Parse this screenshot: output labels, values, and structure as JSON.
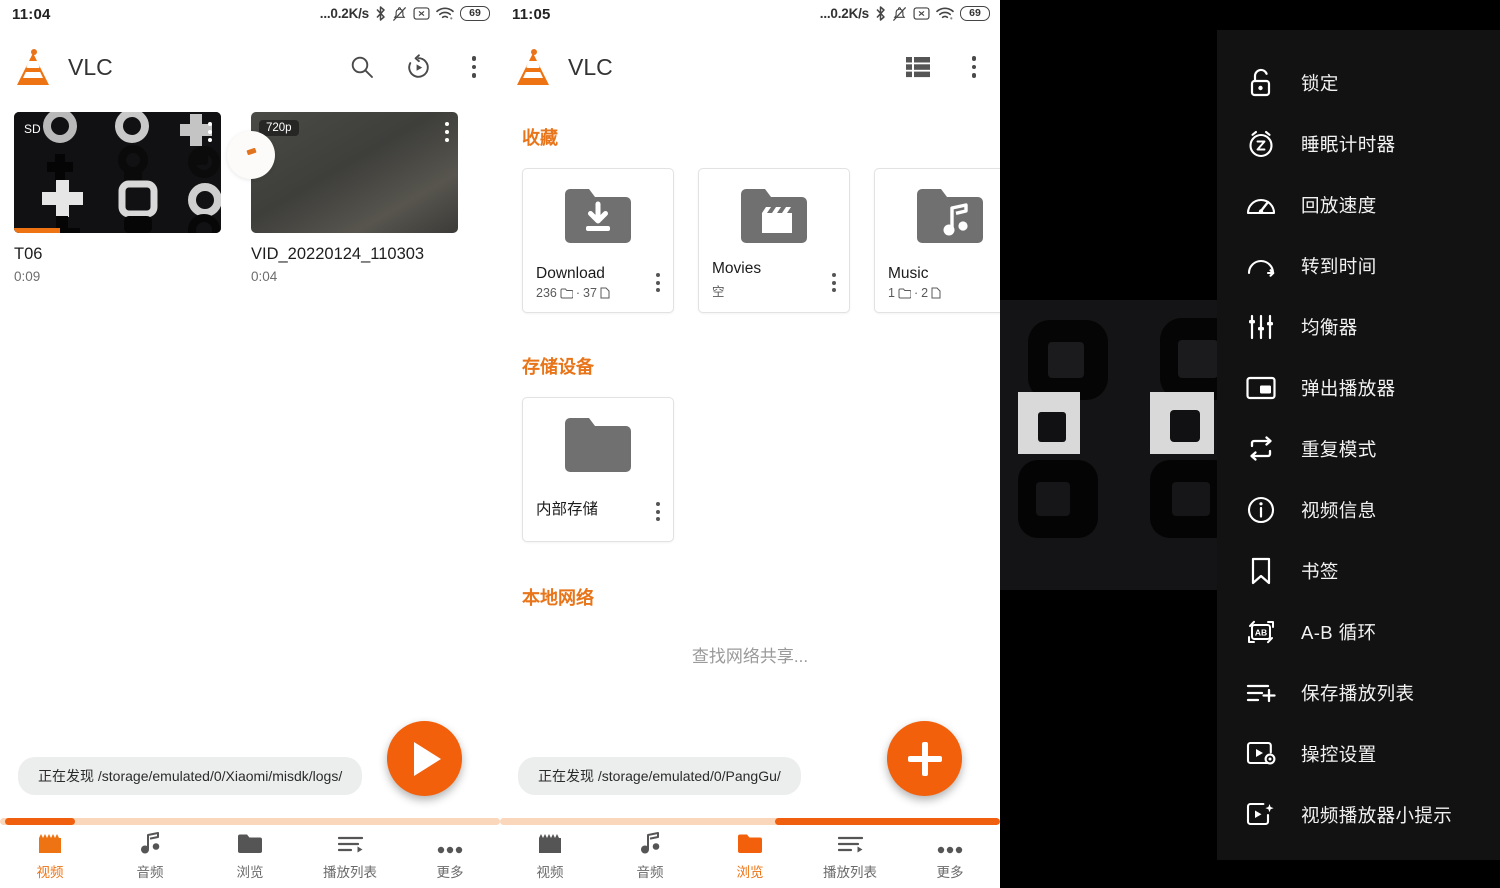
{
  "panel1": {
    "status": {
      "time": "11:04",
      "net_speed": "...0.2K/s",
      "battery": "69",
      "icons": [
        "bluetooth-icon",
        "bell-muted-icon",
        "x-box-icon",
        "wifi-icon",
        "battery-icon"
      ]
    },
    "appbar": {
      "title": "VLC",
      "actions": [
        "search-icon",
        "history-resume-icon",
        "overflow-menu-icon"
      ]
    },
    "videos": [
      {
        "title": "T06",
        "duration": "0:09",
        "quality_badge": "SD",
        "watched_percent": 22
      },
      {
        "title": "VID_20220124_110303",
        "duration": "0:04",
        "quality_badge": "720p",
        "watched_percent": 0
      }
    ],
    "toast": "正在发现 /storage/emulated/0/Xiaomi/misdk/logs/",
    "fab": {
      "icon": "play-icon"
    },
    "progress": {
      "start_percent": 1,
      "end_percent": 15
    },
    "bottomnav": [
      {
        "label": "视频",
        "icon": "video-icon",
        "active": true
      },
      {
        "label": "音频",
        "icon": "audio-icon",
        "active": false
      },
      {
        "label": "浏览",
        "icon": "browse-folder-icon",
        "active": false
      },
      {
        "label": "播放列表",
        "icon": "playlist-icon",
        "active": false
      },
      {
        "label": "更多",
        "icon": "more-icon",
        "active": false
      }
    ]
  },
  "panel2": {
    "status": {
      "time": "11:05",
      "net_speed": "...0.2K/s",
      "battery": "69",
      "icons": [
        "bluetooth-icon",
        "bell-muted-icon",
        "x-box-icon",
        "wifi-icon",
        "battery-icon"
      ]
    },
    "appbar": {
      "title": "VLC",
      "actions": [
        "list-view-icon",
        "overflow-menu-icon"
      ]
    },
    "sections": {
      "favorites_title": "收藏",
      "favorites": [
        {
          "name": "Download",
          "sub": "236 · 37",
          "folders": "236",
          "files": "37",
          "icon": "folder-download-icon"
        },
        {
          "name": "Movies",
          "sub": "空",
          "icon": "folder-movie-icon"
        },
        {
          "name": "Music",
          "sub": "1 · 2",
          "folders": "1",
          "files": "2",
          "icon": "folder-music-icon"
        }
      ],
      "storage_title": "存储设备",
      "storage": [
        {
          "name": "内部存储",
          "icon": "folder-icon"
        }
      ],
      "network_title": "本地网络",
      "network_empty": "查找网络共享..."
    },
    "toast": "正在发现 /storage/emulated/0/PangGu/",
    "fab": {
      "icon": "plus-icon"
    },
    "progress": {
      "start_percent": 55,
      "end_percent": 100
    },
    "bottomnav": [
      {
        "label": "视频",
        "icon": "video-icon",
        "active": false
      },
      {
        "label": "音频",
        "icon": "audio-icon",
        "active": false
      },
      {
        "label": "浏览",
        "icon": "browse-folder-icon",
        "active": true
      },
      {
        "label": "播放列表",
        "icon": "playlist-icon",
        "active": false
      },
      {
        "label": "更多",
        "icon": "more-icon",
        "active": false
      }
    ]
  },
  "panel3": {
    "menu_items": [
      {
        "label": "锁定",
        "icon": "lock-icon"
      },
      {
        "label": "睡眠计时器",
        "icon": "sleep-timer-icon"
      },
      {
        "label": "回放速度",
        "icon": "playback-speed-icon"
      },
      {
        "label": "转到时间",
        "icon": "jump-to-time-icon"
      },
      {
        "label": "均衡器",
        "icon": "equalizer-icon"
      },
      {
        "label": "弹出播放器",
        "icon": "popup-player-icon"
      },
      {
        "label": "重复模式",
        "icon": "repeat-icon"
      },
      {
        "label": "视频信息",
        "icon": "info-icon"
      },
      {
        "label": "书签",
        "icon": "bookmark-icon"
      },
      {
        "label": "A-B 循环",
        "icon": "ab-repeat-icon"
      },
      {
        "label": "保存播放列表",
        "icon": "save-playlist-icon"
      },
      {
        "label": "操控设置",
        "icon": "control-settings-icon"
      },
      {
        "label": "视频播放器小提示",
        "icon": "player-tips-icon"
      }
    ]
  },
  "colors": {
    "accent": "#ee7313",
    "fab": "#f2600c",
    "progress_track": "#fad6bb",
    "menu_bg": "#121212",
    "text_primary": "#1d1d1d",
    "text_secondary": "#6d6d6d"
  }
}
